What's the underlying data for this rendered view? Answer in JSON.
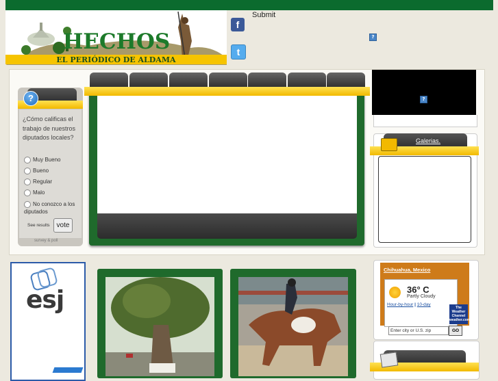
{
  "header": {
    "logo_title": "HECHOS",
    "logo_subtitle": "EL PERIÓDICO DE ALDAMA",
    "submit_label": "Submit",
    "facebook_letter": "f",
    "twitter_letter": "t",
    "help_mark": "?"
  },
  "poll": {
    "help_mark": "?",
    "question": "¿Cómo calificas el trabajo de nuestros diputados locales?",
    "options": [
      "Muy Bueno",
      "Bueno",
      "Regular",
      "Malo",
      "No conozco a los diputados"
    ],
    "results_label": "See results",
    "vote_label": "vote",
    "footer": "survey & poll"
  },
  "nav_tabs_count": 7,
  "ad": {
    "help_mark": "?"
  },
  "gallery": {
    "link_label": "Galerias."
  },
  "sponsor": {
    "logo_text": "esj"
  },
  "weather": {
    "location": "Chihuahua, Mexico",
    "temperature": "36° C",
    "condition": "Partly Cloudy",
    "link_hourly": "Hour-by-hour",
    "separator": "|",
    "link_tenday": "10-day",
    "input_placeholder": "Enter city or U.S. zip",
    "go_label": "GO",
    "channel_logo": "The Weather Channel",
    "channel_site": "weather.com"
  },
  "colors": {
    "green": "#1f6a2c",
    "yellow": "#f6c400",
    "top_bar": "#0b6b2e",
    "facebook": "#3b5998",
    "twitter": "#55acee"
  }
}
